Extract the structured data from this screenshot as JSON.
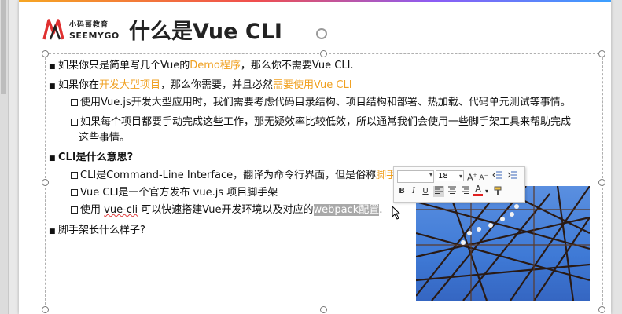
{
  "slide": {
    "logo": {
      "cn": "小码哥教育",
      "en": "SEEMYGO"
    },
    "title": "什么是Vue CLI",
    "items": [
      {
        "level": 1,
        "parts": [
          {
            "t": "如果你只是简单写几个Vue的"
          },
          {
            "t": "Demo程序",
            "hl": true
          },
          {
            "t": "，那么你不需要Vue CLI."
          }
        ]
      },
      {
        "level": 1,
        "parts": [
          {
            "t": "如果你在"
          },
          {
            "t": "开发大型项目",
            "hl": true
          },
          {
            "t": "，那么你需要，并且必然"
          },
          {
            "t": "需要使用Vue CLI",
            "hl": true
          }
        ]
      },
      {
        "level": 2,
        "parts": [
          {
            "t": "使用Vue.js开发大型应用时，我们需要考虑代码目录结构、项目结构和部署、热加载、代码单元测试等事情。"
          }
        ]
      },
      {
        "level": 2,
        "parts": [
          {
            "t": "如果每个项目都要手动完成这些工作，那无疑效率比较低效，所以通常我们会使用一些脚手架工具来帮助完成"
          }
        ]
      },
      {
        "level": 0,
        "parts": [
          {
            "t": "这些事情。"
          }
        ]
      },
      {
        "level": 1,
        "parts": [
          {
            "t": "CLI是什么意思?",
            "bold": true
          }
        ]
      },
      {
        "level": 2,
        "parts": [
          {
            "t": "CLI是Command-Line Interface，翻译为命令行界面，但是俗称"
          },
          {
            "t": "脚手",
            "hl": true
          }
        ]
      },
      {
        "level": 2,
        "parts": [
          {
            "t": "Vue CLI是一个官方发布 vue.js 项目脚手架"
          }
        ]
      },
      {
        "level": 2,
        "parts": [
          {
            "t": "使用 "
          },
          {
            "t": "vue-cli",
            "squig": true
          },
          {
            "t": " 可以快速搭建Vue开发环境以及对应的"
          },
          {
            "t": "webpack配置",
            "sel": true
          },
          {
            "t": "."
          }
        ]
      },
      {
        "level": 1,
        "parts": [
          {
            "t": "脚手架长什么样子?"
          }
        ]
      }
    ]
  },
  "toolbar": {
    "font_size": "18",
    "grow_font": "A",
    "shrink_font": "A",
    "bold": "B",
    "italic": "I",
    "underline": "U",
    "font_color": "A",
    "icons": [
      "decrease-indent-icon",
      "increase-indent-icon",
      "align-left-icon",
      "align-center-icon",
      "align-right-icon",
      "format-painter-icon"
    ]
  },
  "colors": {
    "highlight": "#f0a020",
    "text": "#111111",
    "selection": "#a9a9a9"
  }
}
